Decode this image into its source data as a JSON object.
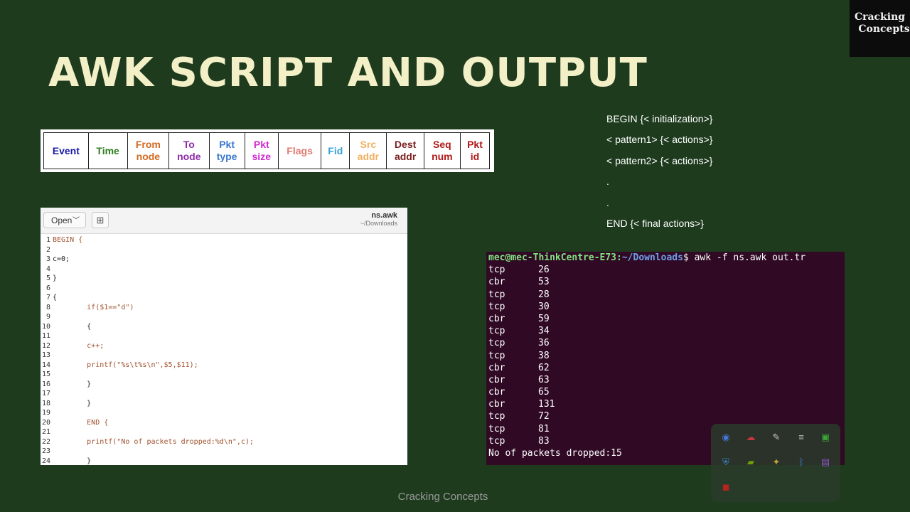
{
  "slide": {
    "title": "AWK SCRIPT AND OUTPUT",
    "footer": "Cracking Concepts"
  },
  "logo": {
    "line1": "Cracking",
    "line2": "Concepts"
  },
  "trace_fields": [
    {
      "line1": "Event",
      "line2": "",
      "color": "#1a1aa6"
    },
    {
      "line1": "Time",
      "line2": "",
      "color": "#2e7d1e"
    },
    {
      "line1": "From",
      "line2": "node",
      "color": "#d2691e"
    },
    {
      "line1": "To",
      "line2": "node",
      "color": "#8e2ba8"
    },
    {
      "line1": "Pkt",
      "line2": "type",
      "color": "#3a78d0"
    },
    {
      "line1": "Pkt",
      "line2": "size",
      "color": "#d02bd0"
    },
    {
      "line1": "Flags",
      "line2": "",
      "color": "#e07a6e"
    },
    {
      "line1": "Fid",
      "line2": "",
      "color": "#3aa0d8"
    },
    {
      "line1": "Src",
      "line2": "addr",
      "color": "#f0b060"
    },
    {
      "line1": "Dest",
      "line2": "addr",
      "color": "#7a1e1e"
    },
    {
      "line1": "Seq",
      "line2": "num",
      "color": "#b01818"
    },
    {
      "line1": "Pkt",
      "line2": "id",
      "color": "#b01818"
    }
  ],
  "syntax": [
    "BEGIN {< initialization>}",
    "< pattern1> {< actions>}",
    "< pattern2> {< actions>}",
    ".",
    ".",
    "END {< final actions>}"
  ],
  "editor": {
    "open_label": "Open",
    "filename": "ns.awk",
    "filepath": "~/Downloads",
    "lines": [
      "BEGIN {",
      "",
      "c=0;",
      "",
      "}",
      "",
      "{",
      "        if($1==\"d\")",
      "",
      "        {",
      "",
      "        c++;",
      "",
      "        printf(\"%s\\t%s\\n\",$5,$11);",
      "",
      "        }",
      "",
      "        }",
      "",
      "        END {",
      "",
      "        printf(\"No of packets dropped:%d\\n\",c);",
      "",
      "        }"
    ]
  },
  "terminal": {
    "user_host": "mec@mec-ThinkCentre-E73",
    "path": "~/Downloads",
    "command": "awk -f ns.awk out.tr",
    "rows": [
      {
        "type": "tcp",
        "value": "26"
      },
      {
        "type": "cbr",
        "value": "53"
      },
      {
        "type": "tcp",
        "value": "28"
      },
      {
        "type": "tcp",
        "value": "30"
      },
      {
        "type": "cbr",
        "value": "59"
      },
      {
        "type": "tcp",
        "value": "34"
      },
      {
        "type": "tcp",
        "value": "36"
      },
      {
        "type": "tcp",
        "value": "38"
      },
      {
        "type": "cbr",
        "value": "62"
      },
      {
        "type": "cbr",
        "value": "63"
      },
      {
        "type": "cbr",
        "value": "65"
      },
      {
        "type": "cbr",
        "value": "131"
      },
      {
        "type": "tcp",
        "value": "72"
      },
      {
        "type": "tcp",
        "value": "81"
      },
      {
        "type": "tcp",
        "value": "83"
      }
    ],
    "summary": "No of packets dropped:15"
  },
  "tray_icons": [
    {
      "name": "chrome-icon",
      "glyph": "◉",
      "color": "#4a8af4"
    },
    {
      "name": "cloud-off-icon",
      "glyph": "☁",
      "color": "#e04040"
    },
    {
      "name": "pen-icon",
      "glyph": "✎",
      "color": "#dddddd"
    },
    {
      "name": "cast-icon",
      "glyph": "≡",
      "color": "#dddddd"
    },
    {
      "name": "app-green-icon",
      "glyph": "▣",
      "color": "#3fbf3f"
    },
    {
      "name": "shield-icon",
      "glyph": "⛨",
      "color": "#3a9ae0"
    },
    {
      "name": "nvidia-icon",
      "glyph": "▰",
      "color": "#76b900"
    },
    {
      "name": "color-picker-icon",
      "glyph": "✦",
      "color": "#e0c040"
    },
    {
      "name": "bluetooth-icon",
      "glyph": "ᛒ",
      "color": "#3a8ae0"
    },
    {
      "name": "onenote-icon",
      "glyph": "▤",
      "color": "#a060e0"
    },
    {
      "name": "mcafee-icon",
      "glyph": "◼",
      "color": "#d02020"
    }
  ]
}
